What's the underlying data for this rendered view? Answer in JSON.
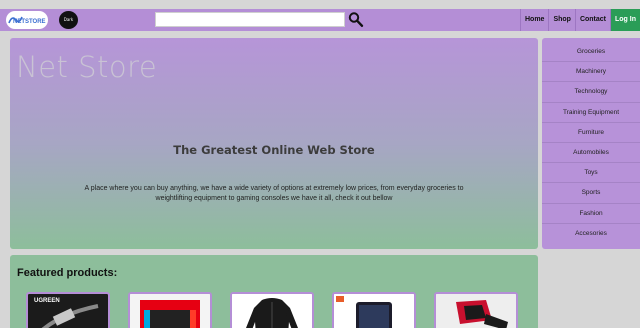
{
  "header": {
    "logo_text": "NETSTORE",
    "dark_mode_label": "Dark",
    "search": {
      "value": "",
      "placeholder": ""
    },
    "nav": [
      {
        "label": "Home"
      },
      {
        "label": "Shop"
      },
      {
        "label": "Contact"
      },
      {
        "label": "Log In"
      }
    ]
  },
  "hero": {
    "title": "Net Store",
    "subtitle": "The Greatest Online Web Store",
    "description": "A place where you can buy anything, we have a wide variety of options at extremely low prices, from everyday groceries to weightlifting equipment to gaming consoles we have it all, check it out bellow"
  },
  "sidebar": {
    "categories": [
      {
        "label": "Groceries"
      },
      {
        "label": "Machinery"
      },
      {
        "label": "Technology"
      },
      {
        "label": "Training Equipment"
      },
      {
        "label": "Furniture"
      },
      {
        "label": "Automobiles"
      },
      {
        "label": "Toys"
      },
      {
        "label": "Sports"
      },
      {
        "label": "Fashion"
      },
      {
        "label": "Accesories"
      }
    ]
  },
  "featured": {
    "title": "Featured products:",
    "products": [
      {
        "image": "hdmi-cable-image",
        "brand_text": "UGREEN"
      },
      {
        "image": "game-console-image"
      },
      {
        "image": "black-jacket-image"
      },
      {
        "image": "smartphone-image"
      },
      {
        "image": "gaming-chair-image"
      }
    ]
  },
  "colors": {
    "navbar": "#b48ed6",
    "sidebar": "#b792d9",
    "hero_top": "#b695d8",
    "hero_bottom": "#8dbe9b",
    "featured_bg": "#8dbe9b",
    "login_button": "#2a9d57",
    "page_bg": "#d6d6d6"
  }
}
